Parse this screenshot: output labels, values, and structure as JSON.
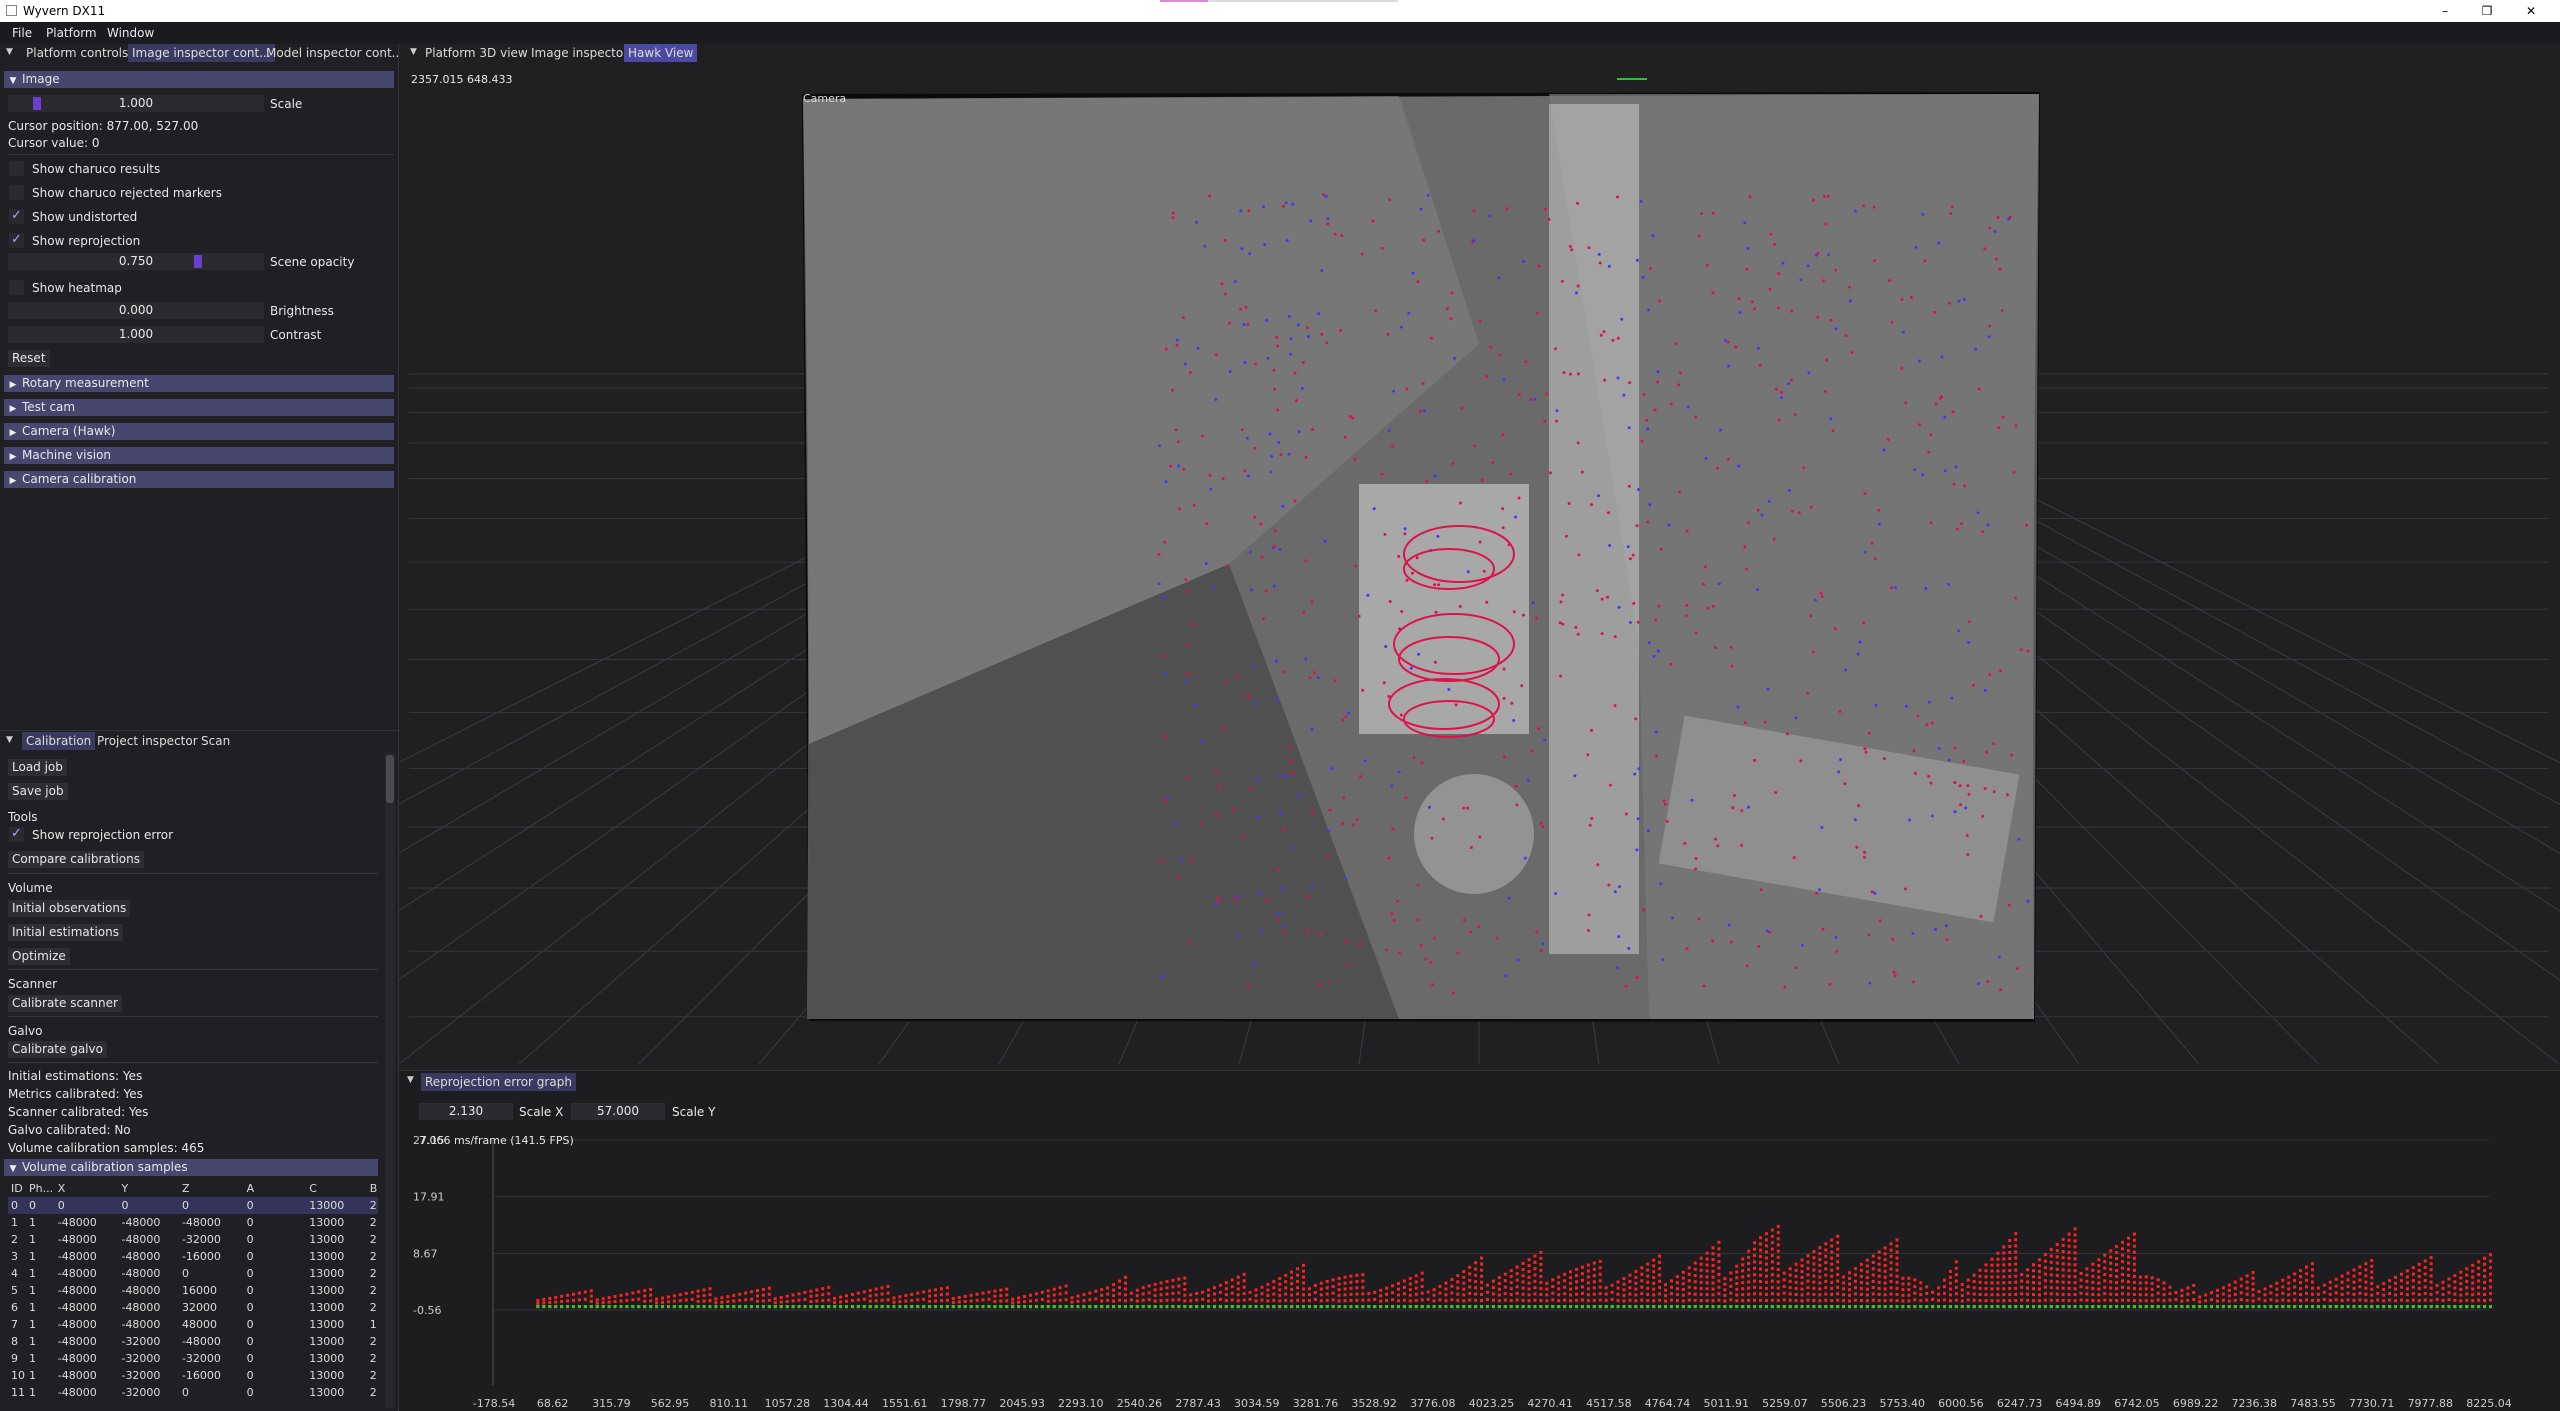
{
  "window": {
    "title": "Wyvern DX11",
    "minimize_glyph": "–",
    "maximize_glyph": "❐",
    "close_glyph": "✕"
  },
  "menu": [
    "File",
    "Platform",
    "Window"
  ],
  "left_top_tabs": [
    "Platform controls",
    "Image inspector cont...",
    "Model inspector cont..."
  ],
  "image_section": {
    "header": "Image",
    "scale_value": "1.000",
    "scale_label": "Scale",
    "cursor_position": "Cursor position: 877.00, 527.00",
    "cursor_value": "Cursor value: 0",
    "show_charuco_results": "Show charuco results",
    "show_charuco_rejected": "Show charuco rejected markers",
    "show_undistorted": "Show undistorted",
    "show_reprojection": "Show reprojection",
    "scene_opacity_value": "0.750",
    "scene_opacity_label": "Scene opacity",
    "scene_opacity_level": 0.75,
    "show_heatmap": "Show heatmap",
    "brightness_value": "0.000",
    "brightness_label": "Brightness",
    "contrast_value": "1.000",
    "contrast_label": "Contrast",
    "reset": "Reset"
  },
  "collapsed_sections": [
    "Rotary measurement",
    "Test cam",
    "Camera (Hawk)",
    "Machine vision",
    "Camera calibration"
  ],
  "bottom_tabs": [
    "Calibration",
    "Project inspector",
    "Scan"
  ],
  "calibration": {
    "load_job": "Load job",
    "save_job": "Save job",
    "tools": "Tools",
    "show_reproj_error": "Show reprojection error",
    "compare_calibrations": "Compare calibrations",
    "volume": "Volume",
    "initial_observations": "Initial observations",
    "initial_estimations": "Initial estimations",
    "optimize": "Optimize",
    "scanner": "Scanner",
    "calibrate_scanner": "Calibrate scanner",
    "galvo": "Galvo",
    "calibrate_galvo": "Calibrate galvo",
    "status": [
      "Initial estimations: Yes",
      "Metrics calibrated: Yes",
      "Scanner calibrated: Yes",
      "Galvo calibrated: No",
      "Volume calibration samples: 465"
    ],
    "samples_header": "Volume calibration samples",
    "columns": [
      "ID",
      "Ph...",
      "X",
      "Y",
      "Z",
      "A",
      "C",
      "B"
    ],
    "rows": [
      [
        "0",
        "0",
        "0",
        "0",
        "0",
        "0",
        "13000",
        "2"
      ],
      [
        "1",
        "1",
        "-48000",
        "-48000",
        "-48000",
        "0",
        "13000",
        "2"
      ],
      [
        "2",
        "1",
        "-48000",
        "-48000",
        "-32000",
        "0",
        "13000",
        "2"
      ],
      [
        "3",
        "1",
        "-48000",
        "-48000",
        "-16000",
        "0",
        "13000",
        "2"
      ],
      [
        "4",
        "1",
        "-48000",
        "-48000",
        "0",
        "0",
        "13000",
        "2"
      ],
      [
        "5",
        "1",
        "-48000",
        "-48000",
        "16000",
        "0",
        "13000",
        "2"
      ],
      [
        "6",
        "1",
        "-48000",
        "-48000",
        "32000",
        "0",
        "13000",
        "2"
      ],
      [
        "7",
        "1",
        "-48000",
        "-48000",
        "48000",
        "0",
        "13000",
        "1"
      ],
      [
        "8",
        "1",
        "-48000",
        "-32000",
        "-48000",
        "0",
        "13000",
        "2"
      ],
      [
        "9",
        "1",
        "-48000",
        "-32000",
        "-32000",
        "0",
        "13000",
        "2"
      ],
      [
        "10",
        "1",
        "-48000",
        "-32000",
        "-16000",
        "0",
        "13000",
        "2"
      ],
      [
        "11",
        "1",
        "-48000",
        "-32000",
        "0",
        "0",
        "13000",
        "2"
      ]
    ]
  },
  "view_tabs": [
    "Platform 3D view",
    "Image inspector",
    "Hawk View"
  ],
  "view": {
    "coords": "2357.015 648.433",
    "camera_label": "Camera"
  },
  "graph": {
    "tab": "Reprojection error graph",
    "scale_x_value": "2.130",
    "scale_x_label": "Scale X",
    "scale_y_value": "57.000",
    "scale_y_label": "Scale Y",
    "fps": "7.066 ms/frame (141.5 FPS)"
  },
  "chart_data": {
    "type": "scatter",
    "title": "Reprojection error graph",
    "y_ticks": [
      "27.15",
      "17.91",
      "8.67",
      "-0.56"
    ],
    "ylim": [
      -0.56,
      27.15
    ],
    "x_ticks": [
      "-178.54",
      "68.62",
      "315.79",
      "562.95",
      "810.11",
      "1057.28",
      "1304.44",
      "1551.61",
      "1798.77",
      "2045.93",
      "2293.10",
      "2540.26",
      "2787.43",
      "3034.59",
      "3281.76",
      "3528.92",
      "3776.08",
      "4023.25",
      "4270.41",
      "4517.58",
      "4764.74",
      "5011.91",
      "5259.07",
      "5506.23",
      "5753.40",
      "6000.56",
      "6247.73",
      "6494.89",
      "6742.05",
      "6989.22",
      "7236.38",
      "7483.55",
      "7730.71",
      "7977.88",
      "8225.04"
    ],
    "xlim": [
      -178.54,
      8225.04
    ],
    "series": [
      {
        "color": "#ff2020",
        "envelope": [
          [
            0,
            2.5
          ],
          [
            500,
            3.0
          ],
          [
            1000,
            3.2
          ],
          [
            1500,
            3.5
          ],
          [
            2000,
            3.0
          ],
          [
            2400,
            4.0
          ],
          [
            2540,
            6.0
          ],
          [
            2800,
            4.5
          ],
          [
            3281,
            7.5
          ],
          [
            3528,
            5.0
          ],
          [
            3776,
            6.0
          ],
          [
            4023,
            9.0
          ],
          [
            4270,
            9.5
          ],
          [
            4517,
            7.5
          ],
          [
            4764,
            9.0
          ],
          [
            5011,
            11.5
          ],
          [
            5130,
            15.0
          ],
          [
            5259,
            13.5
          ],
          [
            5506,
            12.0
          ],
          [
            5753,
            11.5
          ],
          [
            5880,
            3.0
          ],
          [
            6000,
            9.0
          ],
          [
            6247,
            13.0
          ],
          [
            6494,
            13.5
          ],
          [
            6742,
            12.5
          ],
          [
            6900,
            3.0
          ],
          [
            7236,
            6.0
          ],
          [
            7483,
            7.5
          ],
          [
            7730,
            8.0
          ],
          [
            7977,
            8.5
          ],
          [
            8225,
            9.0
          ]
        ]
      },
      {
        "color": "#40c020",
        "envelope": [
          [
            0,
            0.0
          ],
          [
            8225,
            0.0
          ]
        ]
      }
    ]
  },
  "colors": {
    "header": "#46466e",
    "accent": "#6a3fd0",
    "error_points": "#ff2020",
    "ok_points": "#40c020"
  }
}
